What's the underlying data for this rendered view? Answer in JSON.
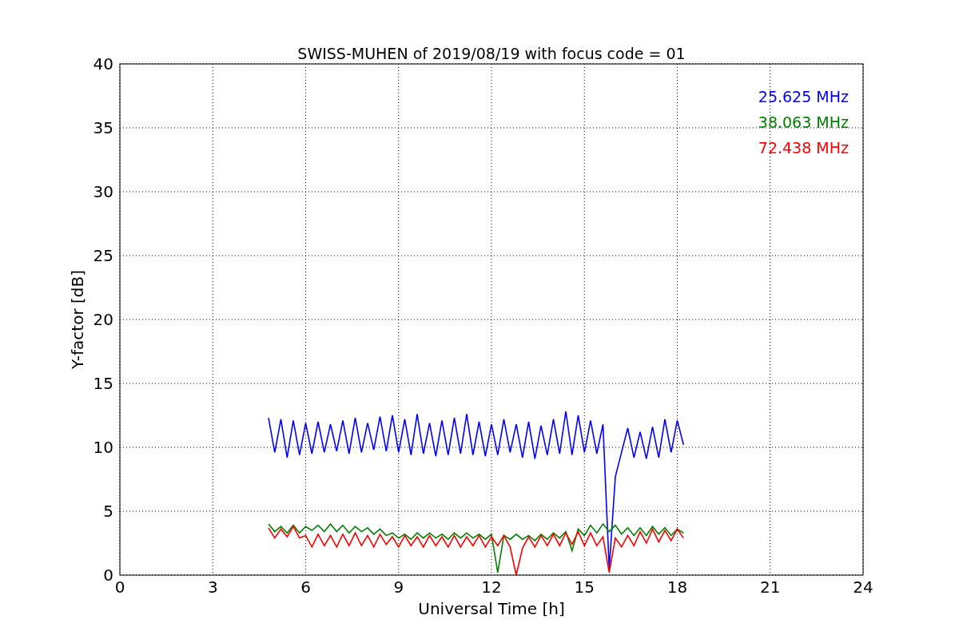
{
  "chart_data": {
    "type": "line",
    "title": "SWISS-MUHEN of 2019/08/19 with focus code = 01",
    "xlabel": "Universal Time [h]",
    "ylabel": "Y-factor [dB]",
    "x": [
      4.8,
      5.0,
      5.2,
      5.4,
      5.6,
      5.8,
      6.0,
      6.2,
      6.4,
      6.6,
      6.8,
      7.0,
      7.2,
      7.4,
      7.6,
      7.8,
      8.0,
      8.2,
      8.4,
      8.6,
      8.8,
      9.0,
      9.2,
      9.4,
      9.6,
      9.8,
      10.0,
      10.2,
      10.4,
      10.6,
      10.8,
      11.0,
      11.2,
      11.4,
      11.6,
      11.8,
      12.0,
      12.2,
      12.4,
      12.6,
      12.8,
      13.0,
      13.2,
      13.4,
      13.6,
      13.8,
      14.0,
      14.2,
      14.4,
      14.6,
      14.8,
      15.0,
      15.2,
      15.4,
      15.6,
      15.8,
      16.0,
      16.2,
      16.4,
      16.6,
      16.8,
      17.0,
      17.2,
      17.4,
      17.6,
      17.8,
      18.0,
      18.2
    ],
    "series": [
      {
        "name": "25.625 MHz",
        "color": "#0000ff",
        "values": [
          12.3,
          9.6,
          12.2,
          9.2,
          12.1,
          9.4,
          11.9,
          9.5,
          12.0,
          9.6,
          11.8,
          9.7,
          12.1,
          9.5,
          12.3,
          9.6,
          11.9,
          9.8,
          12.4,
          9.7,
          12.5,
          9.6,
          12.2,
          9.4,
          12.6,
          9.5,
          11.9,
          9.3,
          12.1,
          9.4,
          12.3,
          9.5,
          12.6,
          9.4,
          12.0,
          9.3,
          11.8,
          9.4,
          12.2,
          9.6,
          11.8,
          9.2,
          12.0,
          9.1,
          11.7,
          9.4,
          12.2,
          9.5,
          12.8,
          9.4,
          12.5,
          9.6,
          12.1,
          9.5,
          11.8,
          0.5,
          7.7,
          9.6,
          11.5,
          9.2,
          11.2,
          9.1,
          11.6,
          9.2,
          12.2,
          9.6,
          12.1,
          10.2
        ]
      },
      {
        "name": "38.063 MHz",
        "color": "#008000",
        "values": [
          4.0,
          3.4,
          3.8,
          3.3,
          3.9,
          3.3,
          3.8,
          3.5,
          3.9,
          3.4,
          4.0,
          3.4,
          3.9,
          3.3,
          3.8,
          3.4,
          3.7,
          3.2,
          3.6,
          3.1,
          3.3,
          2.9,
          3.2,
          2.8,
          3.3,
          2.9,
          3.3,
          2.9,
          3.2,
          2.8,
          3.3,
          2.9,
          3.3,
          2.9,
          3.2,
          2.8,
          3.2,
          0.2,
          3.1,
          2.8,
          3.2,
          2.8,
          3.1,
          2.7,
          3.2,
          2.8,
          3.3,
          2.9,
          3.4,
          1.9,
          3.6,
          3.1,
          3.9,
          3.3,
          4.0,
          3.4,
          3.9,
          3.2,
          3.7,
          3.1,
          3.7,
          3.1,
          3.8,
          3.2,
          3.7,
          3.1,
          3.6,
          3.3
        ]
      },
      {
        "name": "72.438 MHz",
        "color": "#ff0000",
        "values": [
          3.7,
          2.9,
          3.6,
          3.0,
          3.8,
          2.9,
          3.1,
          2.2,
          3.2,
          2.3,
          3.1,
          2.2,
          3.2,
          2.3,
          3.3,
          2.3,
          3.1,
          2.2,
          3.2,
          2.4,
          3.0,
          2.2,
          3.1,
          2.3,
          3.0,
          2.2,
          3.1,
          2.3,
          3.0,
          2.2,
          3.1,
          2.2,
          3.0,
          2.3,
          3.1,
          2.2,
          3.0,
          2.3,
          3.1,
          2.2,
          0.0,
          2.1,
          3.0,
          2.2,
          3.1,
          2.3,
          3.2,
          2.3,
          3.3,
          2.4,
          3.4,
          2.3,
          3.3,
          2.3,
          3.0,
          0.2,
          2.9,
          2.2,
          3.1,
          2.3,
          3.4,
          2.5,
          3.6,
          2.6,
          3.5,
          2.7,
          3.6,
          2.9
        ]
      }
    ],
    "grid": true,
    "xlim": [
      0,
      24
    ],
    "ylim": [
      0,
      40
    ],
    "xticks": [
      0,
      3,
      6,
      9,
      12,
      15,
      18,
      21,
      24
    ],
    "yticks": [
      0,
      5,
      10,
      15,
      20,
      25,
      30,
      35,
      40
    ]
  }
}
